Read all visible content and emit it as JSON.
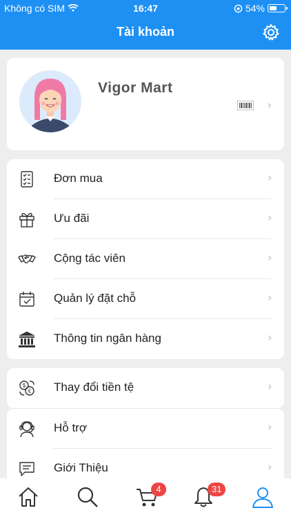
{
  "status_bar": {
    "carrier": "Không có SIM",
    "time": "16:47",
    "battery": "54%",
    "battery_level": 0.54
  },
  "header": {
    "title": "Tài khoản"
  },
  "profile": {
    "name": "Vigor Mart"
  },
  "menu_group_1": [
    {
      "label": "Đơn mua",
      "icon": "order-list-icon"
    },
    {
      "label": "Ưu đãi",
      "icon": "gift-icon"
    },
    {
      "label": "Cộng tác viên",
      "icon": "handshake-icon"
    },
    {
      "label": "Quản lý đặt chỗ",
      "icon": "calendar-icon"
    },
    {
      "label": "Thông tin ngân hàng",
      "icon": "bank-icon"
    }
  ],
  "menu_group_2": [
    {
      "label": "Thay đổi tiền tệ",
      "icon": "currency-exchange-icon"
    },
    {
      "label": "Hỗ trợ",
      "icon": "support-agent-icon"
    },
    {
      "label": "Giới Thiệu",
      "icon": "info-message-icon"
    }
  ],
  "tabbar": {
    "items": [
      {
        "name": "home",
        "icon": "home-icon"
      },
      {
        "name": "search",
        "icon": "search-icon"
      },
      {
        "name": "cart",
        "icon": "cart-icon",
        "badge": "4"
      },
      {
        "name": "notifications",
        "icon": "bell-icon",
        "badge": "31"
      },
      {
        "name": "account",
        "icon": "user-icon",
        "active": true
      }
    ]
  },
  "colors": {
    "primary": "#1e90f4",
    "badge": "#ef4444",
    "background": "#eeeeef"
  }
}
